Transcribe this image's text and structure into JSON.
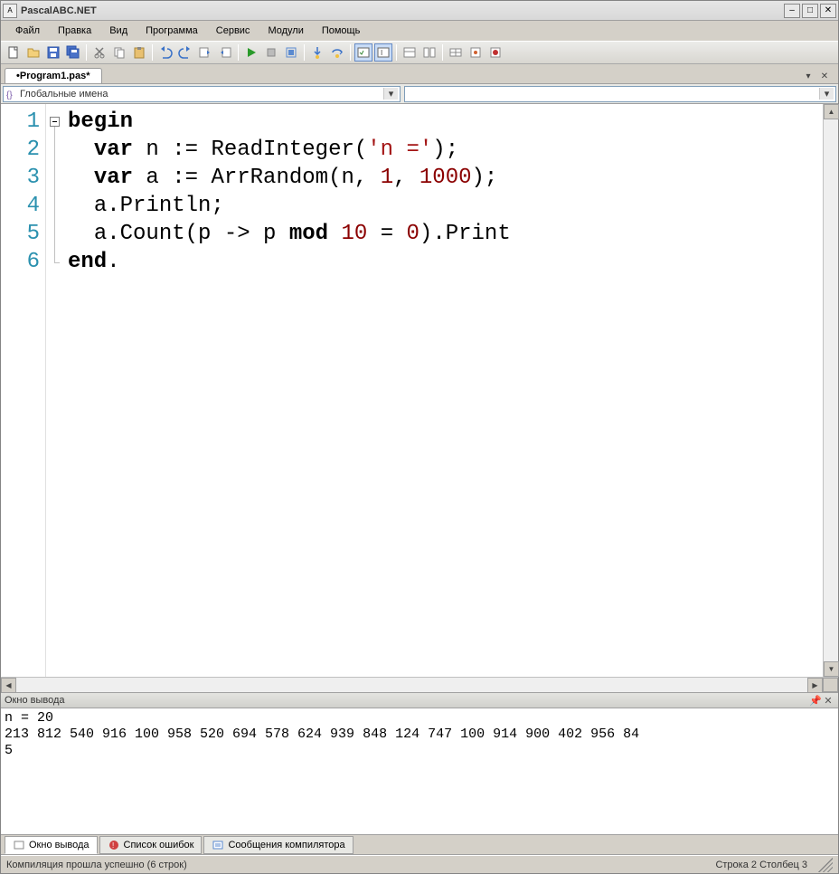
{
  "window": {
    "title": "PascalABC.NET"
  },
  "menu": {
    "items": [
      "Файл",
      "Правка",
      "Вид",
      "Программа",
      "Сервис",
      "Модули",
      "Помощь"
    ]
  },
  "tab": {
    "label": "•Program1.pas*"
  },
  "scope": {
    "left_label": "Глобальные имена"
  },
  "code": {
    "line_numbers": [
      "1",
      "2",
      "3",
      "4",
      "5",
      "6"
    ],
    "lines": [
      {
        "indent": "",
        "tokens": [
          {
            "t": "begin",
            "c": "kw"
          }
        ]
      },
      {
        "indent": "  ",
        "tokens": [
          {
            "t": "var",
            "c": "kw"
          },
          {
            "t": " n := ReadInteger("
          },
          {
            "t": "'n ='",
            "c": "str"
          },
          {
            "t": ");"
          }
        ]
      },
      {
        "indent": "  ",
        "tokens": [
          {
            "t": "var",
            "c": "kw"
          },
          {
            "t": " a := ArrRandom(n, "
          },
          {
            "t": "1",
            "c": "num"
          },
          {
            "t": ", "
          },
          {
            "t": "1000",
            "c": "num"
          },
          {
            "t": ");"
          }
        ]
      },
      {
        "indent": "  ",
        "tokens": [
          {
            "t": "a.Println;"
          }
        ]
      },
      {
        "indent": "  ",
        "tokens": [
          {
            "t": "a.Count(p -> p "
          },
          {
            "t": "mod",
            "c": "kw"
          },
          {
            "t": " "
          },
          {
            "t": "10",
            "c": "num"
          },
          {
            "t": " = "
          },
          {
            "t": "0",
            "c": "num"
          },
          {
            "t": ").Print"
          }
        ]
      },
      {
        "indent": "",
        "tokens": [
          {
            "t": "end",
            "c": "kw"
          },
          {
            "t": "."
          }
        ]
      }
    ]
  },
  "output": {
    "title": "Окно вывода",
    "text": "n = 20\n213 812 540 916 100 958 520 694 578 624 939 848 124 747 100 914 900 402 956 84\n5"
  },
  "bottom_tabs": {
    "items": [
      {
        "label": "Окно вывода"
      },
      {
        "label": "Список ошибок"
      },
      {
        "label": "Сообщения компилятора"
      }
    ]
  },
  "status": {
    "left": "Компиляция прошла успешно (6 строк)",
    "right": "Строка  2 Столбец  3"
  }
}
